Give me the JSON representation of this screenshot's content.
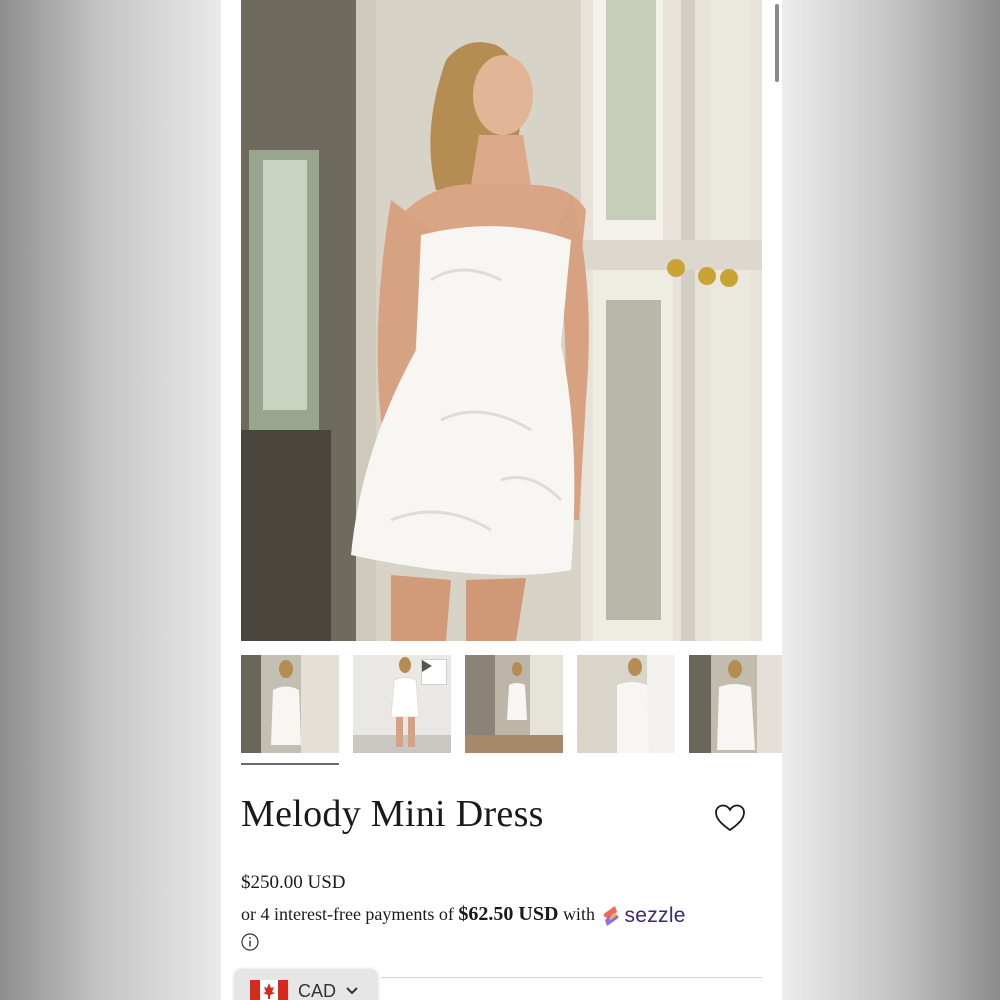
{
  "product": {
    "title": "Melody Mini Dress",
    "price": "$250.00 USD",
    "installments": {
      "prefix": "or 4 interest-free payments of",
      "amount": "$62.50 USD",
      "suffix": "with",
      "provider": "sezzle"
    }
  },
  "gallery": {
    "hero_alt": "Model in white strapless embroidered mini dress by window",
    "thumbnails": [
      {
        "label": "thumbnail-1",
        "video": false,
        "selected": true
      },
      {
        "label": "thumbnail-2",
        "video": true,
        "selected": false
      },
      {
        "label": "thumbnail-3",
        "video": false,
        "selected": false
      },
      {
        "label": "thumbnail-4",
        "video": false,
        "selected": false
      },
      {
        "label": "thumbnail-5",
        "video": false,
        "selected": false
      }
    ]
  },
  "currency_selector": {
    "code": "CAD"
  },
  "icons": {
    "wishlist": "heart-icon",
    "info": "info-icon",
    "play": "play-icon",
    "dropdown": "chevron-down-icon"
  },
  "colors": {
    "text": "#1a1a1a",
    "sezzle_brand": "#3b2a6b"
  }
}
